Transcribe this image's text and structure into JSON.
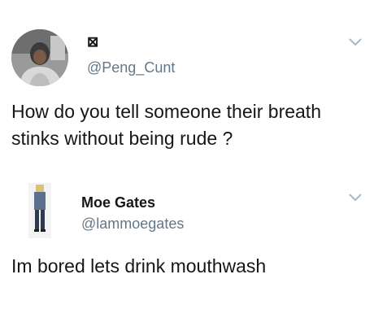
{
  "tweets": [
    {
      "display_name": "⊠",
      "handle": "@Peng_Cunt",
      "text": "How do you tell someone their breath stinks without being rude ?",
      "avatar_icon": "user-photo-avatar",
      "menu_icon": "chevron-down-icon"
    },
    {
      "display_name": "Moe Gates",
      "handle": "@lammoegates",
      "text": "Im bored lets drink mouthwash",
      "avatar_icon": "user-photo-avatar",
      "menu_icon": "chevron-down-icon"
    }
  ],
  "colors": {
    "text_primary": "#14171a",
    "text_secondary": "#657786",
    "chevron": "#aab8c2",
    "background": "#ffffff"
  }
}
